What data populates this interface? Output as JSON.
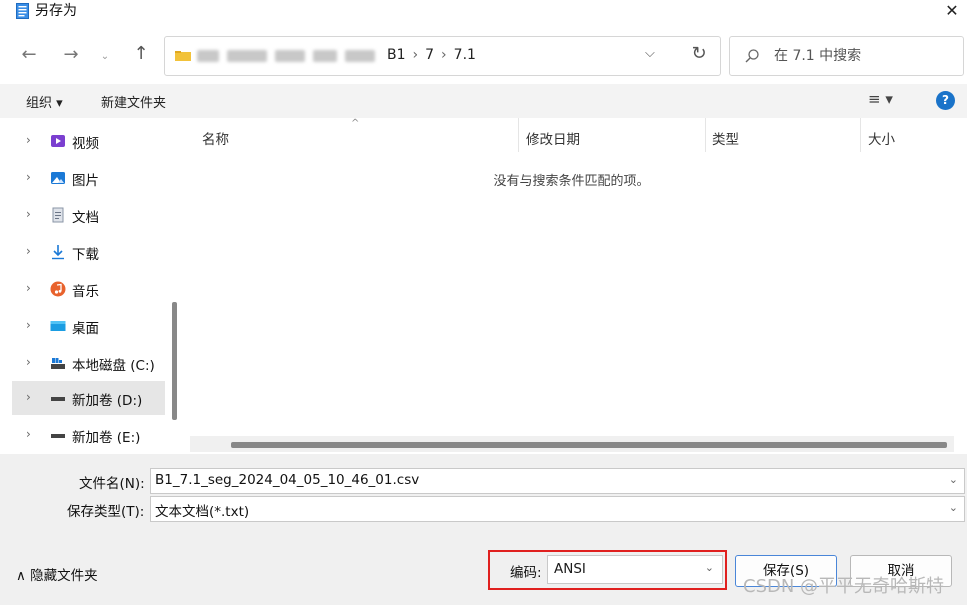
{
  "window": {
    "title": "另存为",
    "close_glyph": "✕"
  },
  "nav": {
    "back_glyph": "←",
    "forward_glyph": "→",
    "history_glyph": "⌄",
    "up_glyph": "↑",
    "breadcrumbs": [
      "B1",
      "7",
      "7.1"
    ],
    "breadcrumb_sep": "›",
    "dropdown_glyph": "⌵",
    "refresh_glyph": "↻",
    "search_placeholder": "在 7.1 中搜索"
  },
  "commandbar": {
    "organize_label": "组织 ▾",
    "newfolder_label": "新建文件夹",
    "view_glyph": "≡ ▾",
    "help_glyph": "?"
  },
  "sidebar": {
    "items": [
      {
        "label": "视频",
        "icon": "video-icon",
        "selected": false
      },
      {
        "label": "图片",
        "icon": "pictures-icon",
        "selected": false
      },
      {
        "label": "文档",
        "icon": "documents-icon",
        "selected": false
      },
      {
        "label": "下载",
        "icon": "download-icon",
        "selected": false
      },
      {
        "label": "音乐",
        "icon": "music-icon",
        "selected": false
      },
      {
        "label": "桌面",
        "icon": "desktop-icon",
        "selected": false
      },
      {
        "label": "本地磁盘 (C:)",
        "icon": "drive-icon",
        "selected": false
      },
      {
        "label": "新加卷 (D:)",
        "icon": "drive-icon",
        "selected": true
      },
      {
        "label": "新加卷 (E:)",
        "icon": "drive-icon",
        "selected": false
      }
    ]
  },
  "filelist": {
    "columns": [
      "名称",
      "修改日期",
      "类型",
      "大小"
    ],
    "sort_glyph": "^",
    "empty_message": "没有与搜索条件匹配的项。"
  },
  "form": {
    "filename_label": "文件名(N):",
    "filename_value": "B1_7.1_seg_2024_04_05_10_46_01.csv",
    "filetype_label": "保存类型(T):",
    "filetype_value": "文本文档(*.txt)",
    "hide_folders_label": "∧ 隐藏文件夹",
    "encoding_label": "编码:",
    "encoding_value": "ANSI",
    "save_label": "保存(S)",
    "cancel_label": "取消",
    "dropdown_glyph": "⌄"
  },
  "watermark": "CSDN @平平无奇哈斯特",
  "colors": {
    "accent": "#1a73c9",
    "highlight_border": "#e0201f",
    "selected_bg": "#e6e6e6"
  }
}
